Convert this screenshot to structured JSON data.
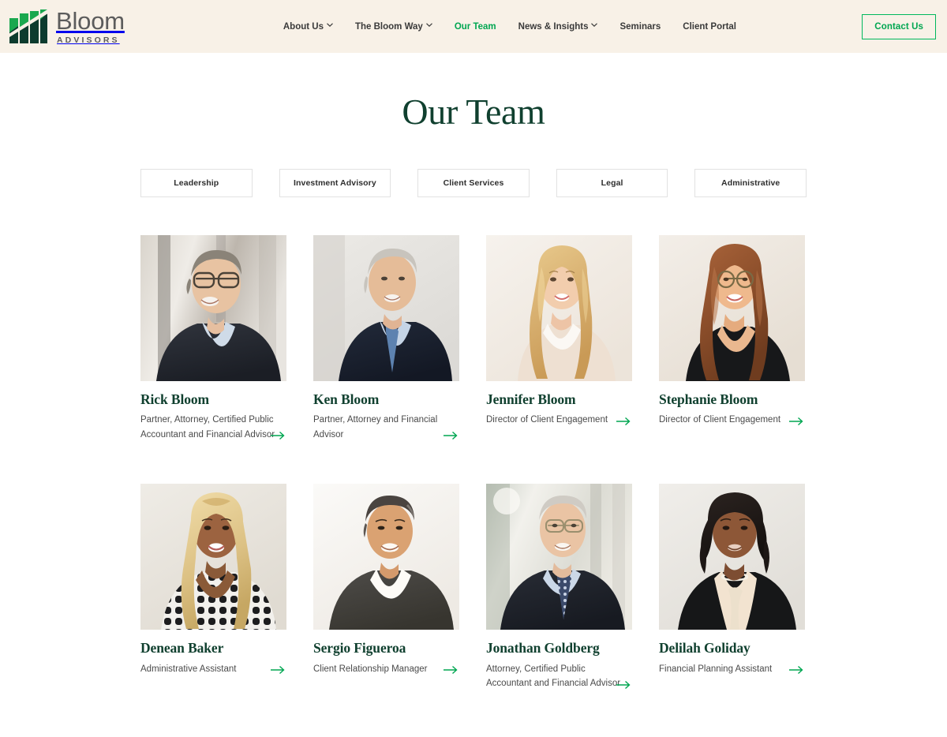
{
  "brand": {
    "name": "Bloom",
    "tagline": "ADVISORS",
    "logo_icon": "bloom-bars-logo",
    "colors": {
      "green_light": "#1aa84f",
      "green_dark": "#0d3b2e",
      "accent": "#00a651",
      "header_bg": "#f8f1e7",
      "title": "#10402f"
    }
  },
  "nav": {
    "items": [
      {
        "label": "About Us",
        "has_dropdown": true,
        "active": false,
        "icon": "chevron-down-icon"
      },
      {
        "label": "The Bloom Way",
        "has_dropdown": true,
        "active": false,
        "icon": "chevron-down-icon"
      },
      {
        "label": "Our Team",
        "has_dropdown": false,
        "active": true,
        "icon": ""
      },
      {
        "label": "News & Insights",
        "has_dropdown": true,
        "active": false,
        "icon": "chevron-down-icon"
      },
      {
        "label": "Seminars",
        "has_dropdown": false,
        "active": false,
        "icon": ""
      },
      {
        "label": "Client Portal",
        "has_dropdown": false,
        "active": false,
        "icon": ""
      }
    ],
    "cta_label": "Contact Us"
  },
  "main": {
    "title": "Our Team",
    "filters": [
      {
        "label": "Leadership"
      },
      {
        "label": "Investment Advisory"
      },
      {
        "label": "Client Services"
      },
      {
        "label": "Legal"
      },
      {
        "label": "Administrative"
      }
    ],
    "arrow_icon": "arrow-right-icon",
    "members": [
      {
        "name": "Rick Bloom",
        "role": "Partner, Attorney, Certified Public Accountant and Financial Advisor",
        "photo_alt": "Portrait of Rick Bloom"
      },
      {
        "name": "Ken Bloom",
        "role": "Partner, Attorney and Financial Advisor",
        "photo_alt": "Portrait of Ken Bloom"
      },
      {
        "name": "Jennifer Bloom",
        "role": "Director of Client Engagement",
        "photo_alt": "Portrait of Jennifer Bloom"
      },
      {
        "name": "Stephanie Bloom",
        "role": "Director of Client Engagement",
        "photo_alt": "Portrait of Stephanie Bloom"
      },
      {
        "name": "Denean Baker",
        "role": "Administrative Assistant",
        "photo_alt": "Portrait of Denean Baker"
      },
      {
        "name": "Sergio Figueroa",
        "role": "Client Relationship Manager",
        "photo_alt": "Portrait of Sergio Figueroa"
      },
      {
        "name": "Jonathan Goldberg",
        "role": "Attorney, Certified Public Accountant and Financial Advisor",
        "photo_alt": "Portrait of Jonathan Goldberg"
      },
      {
        "name": "Delilah Goliday",
        "role": "Financial Planning Assistant",
        "photo_alt": "Portrait of Delilah Goliday"
      }
    ]
  }
}
